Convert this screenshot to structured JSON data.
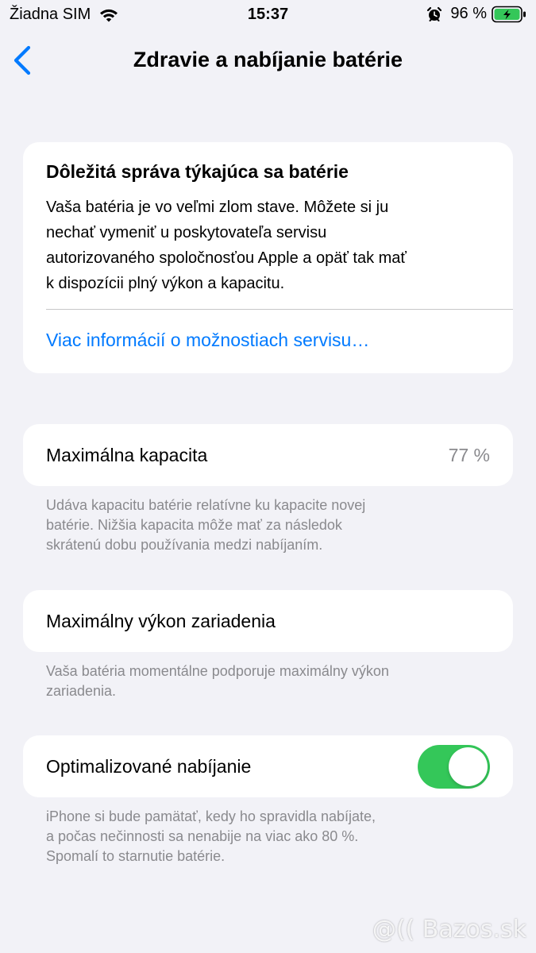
{
  "status_bar": {
    "carrier": "Žiadna SIM",
    "time": "15:37",
    "battery_percent": "96 %"
  },
  "nav": {
    "title": "Zdravie a nabíjanie batérie"
  },
  "message_card": {
    "title": "Dôležitá správa týkajúca sa batérie",
    "lines": [
      "Vaša batéria je vo veľmi zlom stave. Môžete si ju",
      "nechať vymeniť u poskytovateľa servisu",
      "autorizovaného spoločnosťou Apple a opäť tak mať",
      "k dispozícii plný výkon a kapacitu."
    ],
    "link": "Viac informácií o možnostiach servisu…"
  },
  "capacity": {
    "label": "Maximálna kapacita",
    "value": "77 %",
    "footnote_lines": [
      "Udáva kapacitu batérie relatívne ku kapacite novej",
      "batérie. Nižšia kapacita môže mať za následok",
      "skrátenú dobu používania medzi nabíjaním."
    ]
  },
  "performance": {
    "label": "Maximálny výkon zariadenia",
    "footnote_lines": [
      "Vaša batéria momentálne podporuje maximálny výkon",
      "zariadenia."
    ]
  },
  "optimized_charging": {
    "label": "Optimalizované nabíjanie",
    "enabled": true,
    "footnote_lines": [
      "iPhone si bude pamätať, kedy ho spravidla nabíjate,",
      "a počas nečinnosti sa nenabije na viac ako 80 %.",
      "Spomalí to starnutie batérie."
    ]
  },
  "watermark": "@(( Bazos.sk",
  "colors": {
    "accent": "#007aff",
    "toggle_on": "#34c759",
    "battery_charging": "#34c759",
    "background": "#f2f2f7"
  },
  "icons": [
    "wifi-icon",
    "alarm-icon",
    "battery-icon",
    "back-chevron-icon"
  ]
}
